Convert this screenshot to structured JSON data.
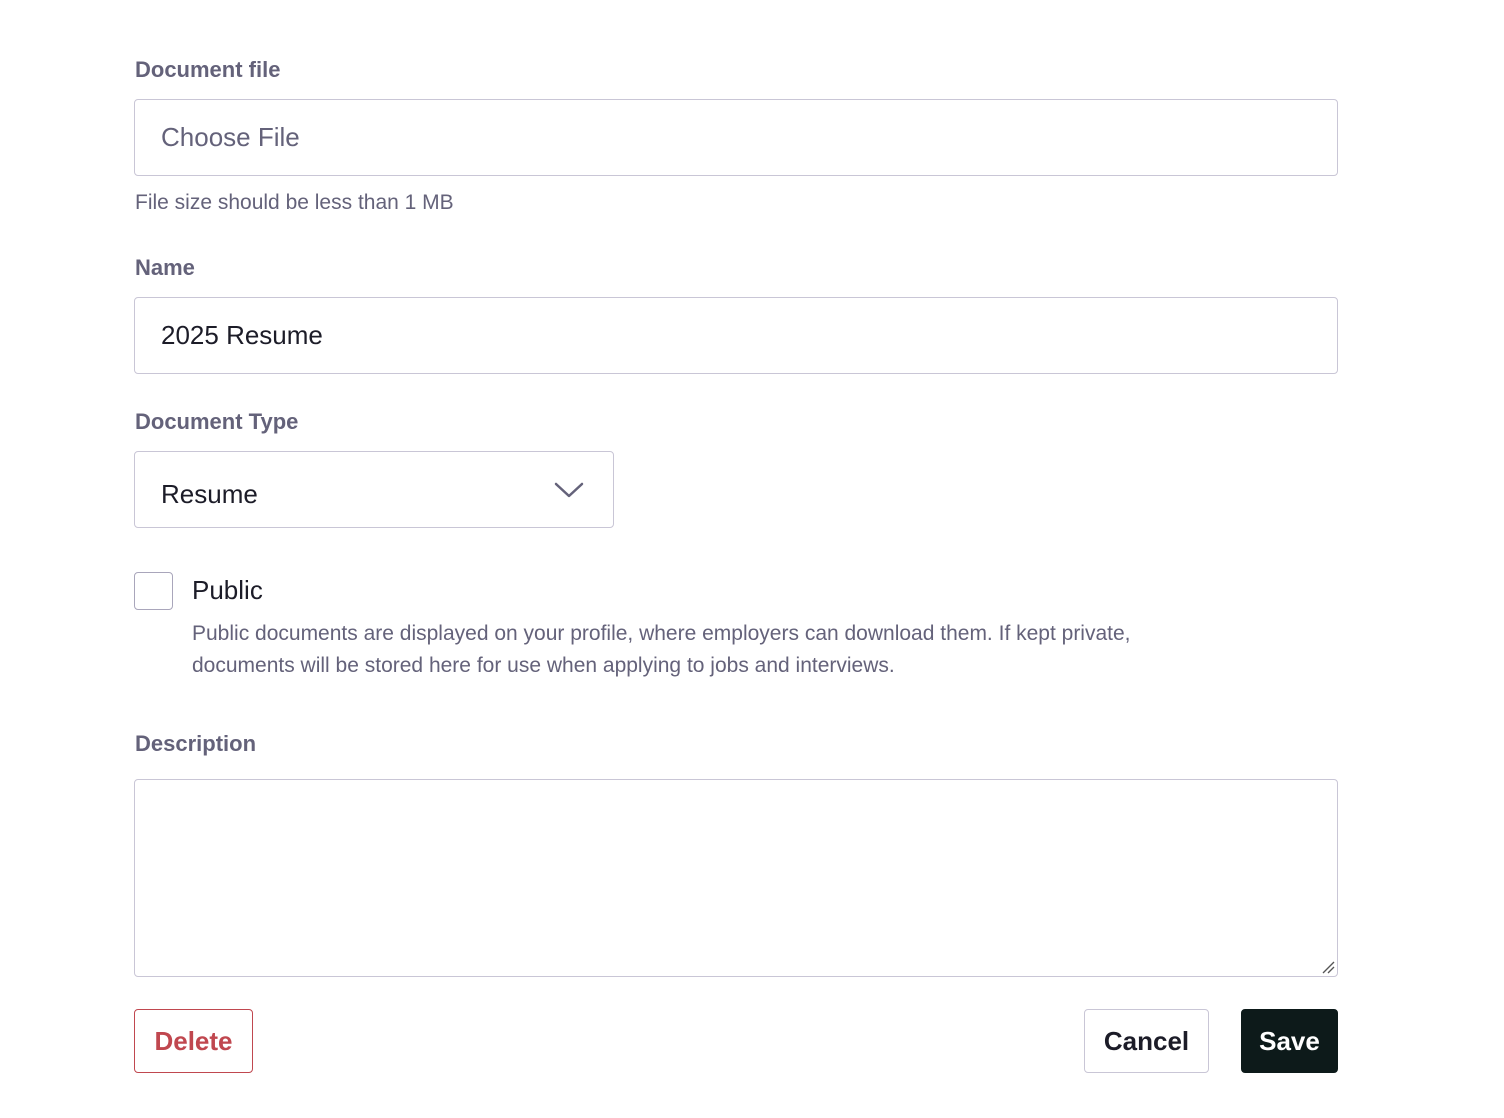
{
  "document_file": {
    "label": "Document file",
    "button_label": "Choose File",
    "help": "File size should be less than 1 MB"
  },
  "name_field": {
    "label": "Name",
    "value": "2025 Resume"
  },
  "document_type": {
    "label": "Document Type",
    "selected": "Resume",
    "icon": "chevron-down-icon"
  },
  "public_option": {
    "label": "Public",
    "checked": false,
    "description_line1": "Public documents are displayed on your profile, where employers can download them. If kept private,",
    "description_line2": "documents will be stored here for use when applying to jobs and interviews."
  },
  "description_field": {
    "label": "Description",
    "value": ""
  },
  "actions": {
    "delete_label": "Delete",
    "cancel_label": "Cancel",
    "save_label": "Save"
  },
  "colors": {
    "label": "#64627a",
    "border": "#c9c6d6",
    "text": "#1c1c28",
    "delete": "#c0474f",
    "save_bg": "#0d1a1a"
  }
}
